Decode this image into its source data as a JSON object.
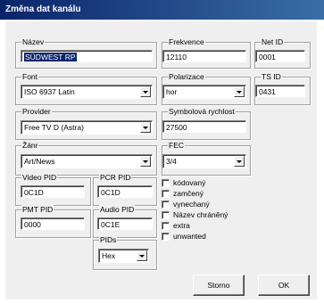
{
  "window": {
    "title": "Změna dat kanálu"
  },
  "fields": {
    "nazev": {
      "label": "Název",
      "value": "SÜDWEST RP"
    },
    "frekvence": {
      "label": "Frekvence",
      "value": "12110"
    },
    "net_id": {
      "label": "Net ID",
      "value": "0001"
    },
    "font": {
      "label": "Font",
      "value": "ISO 6937 Latin"
    },
    "polarizace": {
      "label": "Polarizace",
      "value": "hor"
    },
    "ts_id": {
      "label": "TS ID",
      "value": "0431"
    },
    "provider": {
      "label": "Provider",
      "value": "Free TV D (Astra)"
    },
    "symbolova_rychlost": {
      "label": "Symbolová rychlost",
      "value": "27500"
    },
    "zanr": {
      "label": "Žánr",
      "value": "Art/News"
    },
    "fec": {
      "label": "FEC",
      "value": "3/4"
    },
    "video_pid": {
      "label": "Video PID",
      "value": "0C1D"
    },
    "pcr_pid": {
      "label": "PCR PID",
      "value": "0C1D"
    },
    "pmt_pid": {
      "label": "PMT PID",
      "value": "0000"
    },
    "audio_pid": {
      "label": "Audio PID",
      "value": "0C1E"
    },
    "pids": {
      "label": "PIDs",
      "value": "Hex"
    }
  },
  "checkboxes": [
    {
      "label": "kódovaný",
      "checked": false
    },
    {
      "label": "zamčený",
      "checked": false
    },
    {
      "label": "vynechaný",
      "checked": false
    },
    {
      "label": "Název chráněný",
      "checked": false
    },
    {
      "label": "extra",
      "checked": false
    },
    {
      "label": "unwanted",
      "checked": false
    }
  ],
  "buttons": {
    "cancel": "Storno",
    "ok": "OK"
  }
}
